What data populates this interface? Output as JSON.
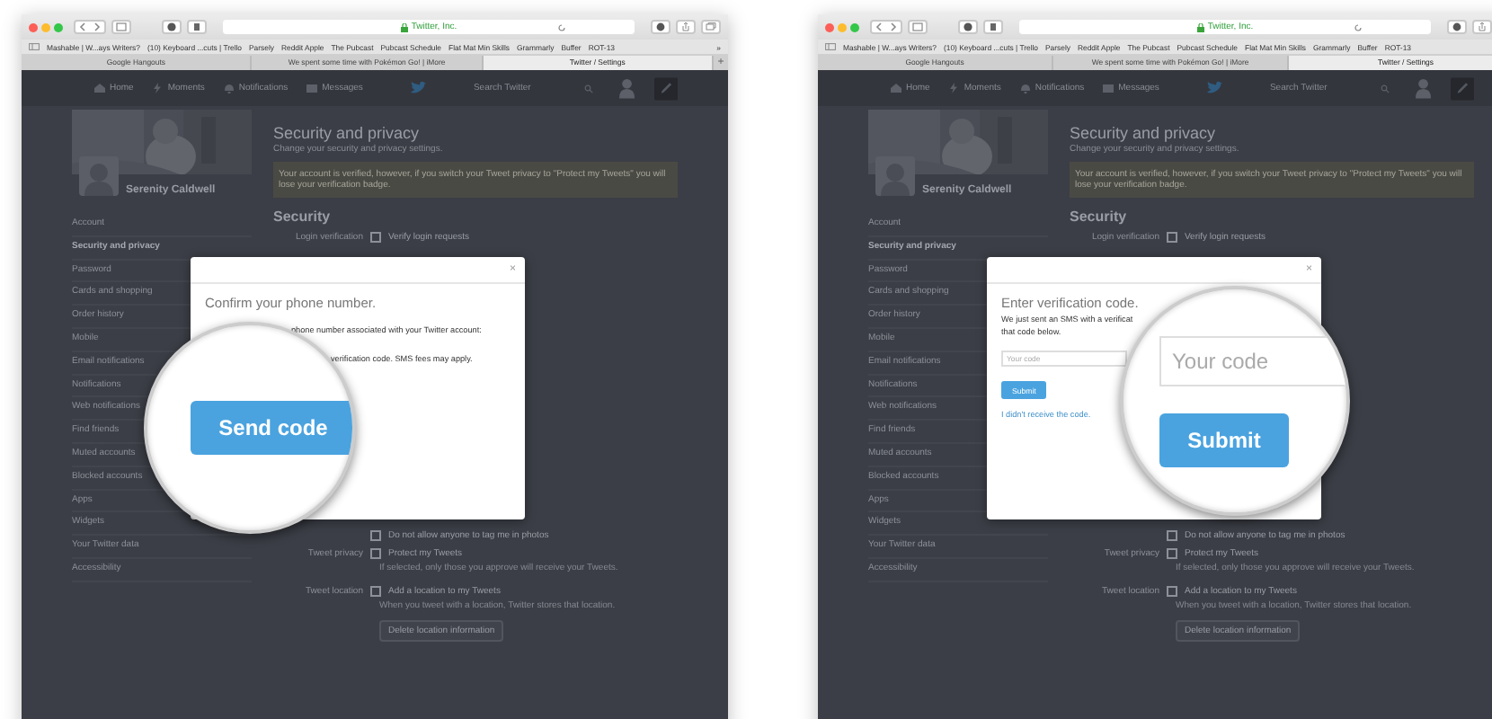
{
  "windows": [
    {
      "url": "Twitter, Inc.",
      "bookmarks": [
        "Mashable | W...ays Writers?",
        "(10) Keyboard ...cuts | Trello",
        "Parsely",
        "Reddit Apple",
        "The Pubcast",
        "Pubcast Schedule",
        "Flat Mat Min Skills",
        "Grammarly",
        "Buffer",
        "ROT-13"
      ],
      "bookmarks_more": "»",
      "tabs": [
        {
          "label": "Google Hangouts",
          "selected": false
        },
        {
          "label": "We spent some time with Pokémon Go! | iMore",
          "selected": false
        },
        {
          "label": "Twitter / Settings",
          "selected": true
        }
      ],
      "new_tab": "+",
      "nav": [
        "Home",
        "Moments",
        "Notifications",
        "Messages"
      ],
      "search_placeholder": "Search Twitter",
      "profile": {
        "name": "Serenity Caldwell"
      },
      "sidebar": [
        {
          "label": "Account",
          "selected": false
        },
        {
          "label": "Security and privacy",
          "selected": true
        },
        {
          "label": "Password",
          "selected": false
        },
        {
          "label": "Cards and shopping",
          "selected": false
        },
        {
          "label": "Order history",
          "selected": false
        },
        {
          "label": "Mobile",
          "selected": false
        },
        {
          "label": "Email notifications",
          "selected": false
        },
        {
          "label": "Notifications",
          "selected": false
        },
        {
          "label": "Web notifications",
          "selected": false
        },
        {
          "label": "Find friends",
          "selected": false
        },
        {
          "label": "Muted accounts",
          "selected": false
        },
        {
          "label": "Blocked accounts",
          "selected": false
        },
        {
          "label": "Apps",
          "selected": false
        },
        {
          "label": "Widgets",
          "selected": false
        },
        {
          "label": "Your Twitter data",
          "selected": false
        },
        {
          "label": "Accessibility",
          "selected": false
        }
      ],
      "title": "Security and privacy",
      "subtitle": "Change your security and privacy settings.",
      "notice": "Your account is verified, however, if you switch your Tweet privacy to \"Protect my Tweets\" you will lose your verification badge.",
      "section": "Security",
      "top_rows": [
        {
          "label": "Login verification",
          "option": "Verify login requests",
          "checked": false
        }
      ],
      "bottom_rows": [
        {
          "label": "",
          "option": "Do not allow anyone to tag me in photos",
          "checked": false
        },
        {
          "label": "Tweet privacy",
          "option": "Protect my Tweets",
          "checked": false,
          "note": "If selected, only those you approve will receive your Tweets."
        },
        {
          "label": "Tweet location",
          "option": "Add a location to my Tweets",
          "checked": false,
          "note": "When you tweet with a location, Twitter stores that location."
        }
      ],
      "delete_button": "Delete location information",
      "modal": {
        "kind": "confirm",
        "close": "×",
        "title": "Confirm your phone number.",
        "lines": [
          "phone number associated with your Twitter account:",
          "verification code. SMS fees may apply."
        ]
      },
      "magnifier": {
        "kind": "button",
        "button": "Send code"
      }
    },
    {
      "url": "Twitter, Inc.",
      "bookmarks": [
        "Mashable | W...ays Writers?",
        "(10) Keyboard ...cuts | Trello",
        "Parsely",
        "Reddit Apple",
        "The Pubcast",
        "Pubcast Schedule",
        "Flat Mat Min Skills",
        "Grammarly",
        "Buffer",
        "ROT-13"
      ],
      "tabs": [
        {
          "label": "Google Hangouts",
          "selected": false
        },
        {
          "label": "We spent some time with Pokémon Go! | iMore",
          "selected": false
        },
        {
          "label": "Twitter / Settings",
          "selected": true
        }
      ],
      "nav": [
        "Home",
        "Moments",
        "Notifications",
        "Messages"
      ],
      "search_placeholder": "Search Twitter",
      "profile": {
        "name": "Serenity Caldwell"
      },
      "sidebar": [
        {
          "label": "Account",
          "selected": false
        },
        {
          "label": "Security and privacy",
          "selected": true
        },
        {
          "label": "Password",
          "selected": false
        },
        {
          "label": "Cards and shopping",
          "selected": false
        },
        {
          "label": "Order history",
          "selected": false
        },
        {
          "label": "Mobile",
          "selected": false
        },
        {
          "label": "Email notifications",
          "selected": false
        },
        {
          "label": "Notifications",
          "selected": false
        },
        {
          "label": "Web notifications",
          "selected": false
        },
        {
          "label": "Find friends",
          "selected": false
        },
        {
          "label": "Muted accounts",
          "selected": false
        },
        {
          "label": "Blocked accounts",
          "selected": false
        },
        {
          "label": "Apps",
          "selected": false
        },
        {
          "label": "Widgets",
          "selected": false
        },
        {
          "label": "Your Twitter data",
          "selected": false
        },
        {
          "label": "Accessibility",
          "selected": false
        }
      ],
      "title": "Security and privacy",
      "subtitle": "Change your security and privacy settings.",
      "notice": "Your account is verified, however, if you switch your Tweet privacy to \"Protect my Tweets\" you will lose your verification badge.",
      "section": "Security",
      "top_rows": [
        {
          "label": "Login verification",
          "option": "Verify login requests",
          "checked": false
        }
      ],
      "bottom_rows": [
        {
          "label": "",
          "option": "Do not allow anyone to tag me in photos",
          "checked": false
        },
        {
          "label": "Tweet privacy",
          "option": "Protect my Tweets",
          "checked": false,
          "note": "If selected, only those you approve will receive your Tweets."
        },
        {
          "label": "Tweet location",
          "option": "Add a location to my Tweets",
          "checked": false,
          "note": "When you tweet with a location, Twitter stores that location."
        }
      ],
      "delete_button": "Delete location information",
      "modal": {
        "kind": "verify",
        "close": "×",
        "title": "Enter verification code.",
        "lines": [
          "We just sent an SMS with a verificat",
          "that code below."
        ],
        "placeholder": "Your code",
        "button": "Submit",
        "link": "I didn't receive the code."
      },
      "magnifier": {
        "kind": "field_button",
        "placeholder": "Your code",
        "button": "Submit"
      }
    }
  ]
}
